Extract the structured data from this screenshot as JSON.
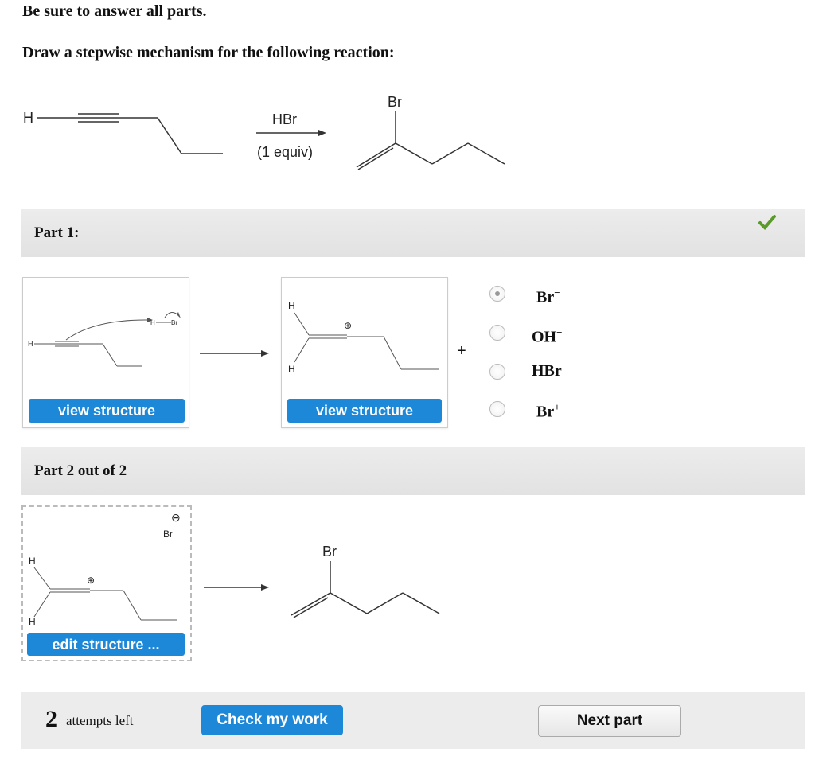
{
  "instructions": {
    "line1": "Be sure to answer all parts.",
    "line2": "Draw a stepwise mechanism for the following reaction:"
  },
  "reaction": {
    "reactant_h": "H",
    "reagent": "HBr",
    "conditions": "(1 equiv)",
    "product_br": "Br"
  },
  "part1": {
    "title": "Part 1:",
    "check_icon": "checkmark-icon",
    "box1": {
      "h_label": "H",
      "hbr_h": "H",
      "hbr_br": "Br",
      "button": "view structure"
    },
    "box2": {
      "h_top": "H",
      "h_bottom": "H",
      "charge": "⊕",
      "button": "view structure"
    },
    "plus": "+",
    "options": [
      {
        "label": "Br",
        "sup": "−",
        "selected": true
      },
      {
        "label": "OH",
        "sup": "−",
        "selected": false
      },
      {
        "label": "HBr",
        "sup": "",
        "selected": false
      },
      {
        "label": "Br",
        "sup": "+",
        "selected": false
      }
    ]
  },
  "part2": {
    "title": "Part 2 out of 2",
    "box": {
      "minus": "⊖",
      "br": "Br",
      "h_top": "H",
      "h_bottom": "H",
      "plus_charge": "⊕",
      "button": "edit structure ..."
    },
    "product_br": "Br"
  },
  "footer": {
    "attempts_number": "2",
    "attempts_text": "attempts left",
    "check_button": "Check my work",
    "next_button": "Next part"
  },
  "colors": {
    "accent": "#1e88d8",
    "check": "#5a9a2a"
  }
}
